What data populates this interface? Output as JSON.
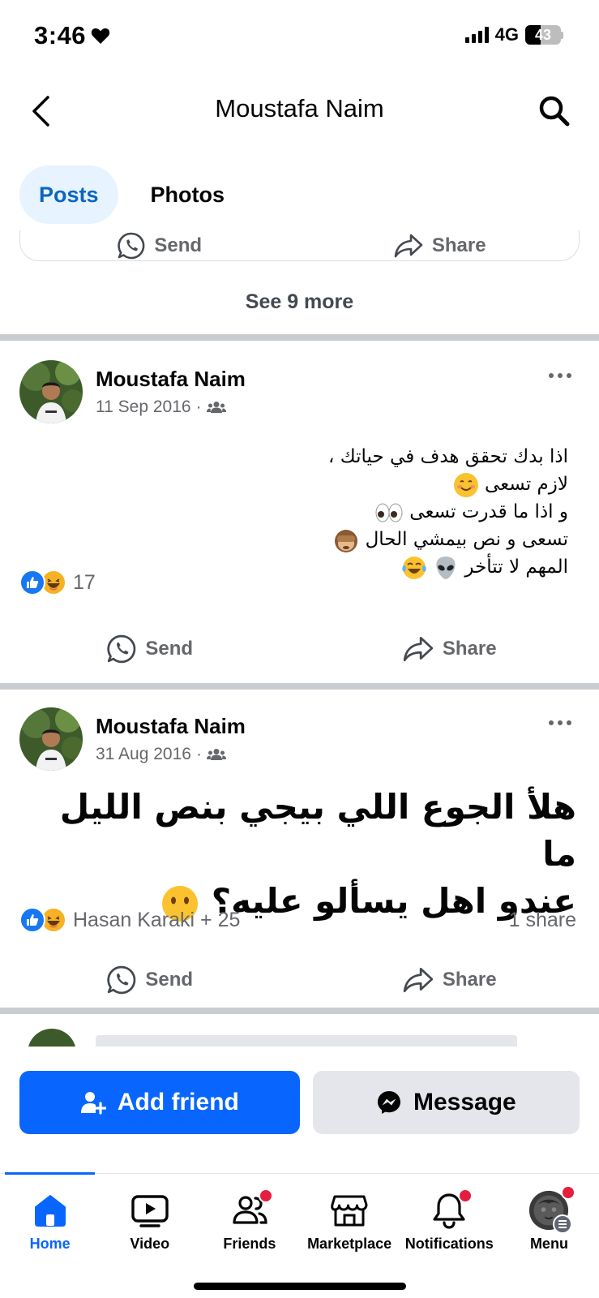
{
  "status_bar": {
    "time": "3:46",
    "network": "4G",
    "battery": "43",
    "battery_level": 0.43
  },
  "header": {
    "title": "Moustafa Naim",
    "back_icon": "chevron-left-icon",
    "search_icon": "search-icon"
  },
  "tabs": [
    {
      "label": "Posts",
      "active": true
    },
    {
      "label": "Photos",
      "active": false
    }
  ],
  "prev_post": {
    "send_label": "Send",
    "share_label": "Share",
    "see_more_label": "See 9 more"
  },
  "posts": [
    {
      "author": "Moustafa Naim",
      "date": "11 Sep 2016",
      "audience_sep": "·",
      "audience_icon": "friends-icon",
      "text_lines": [
        "اذا بدك تحقق هدف في حياتك ،",
        "لازم تسعى",
        "و اذا ما قدرت تسعى",
        "تسعى و نص بيمشي الحال",
        "المهم لا تتأخر"
      ],
      "reaction_count": "17",
      "send_label": "Send",
      "share_label": "Share"
    },
    {
      "author": "Moustafa Naim",
      "date": "31 Aug 2016",
      "audience_sep": "·",
      "audience_icon": "friends-icon",
      "text_lines": [
        "هلأ الجوع اللي بيجي بنص الليل ما",
        "عندو اهل يسألو عليه؟"
      ],
      "reaction_summary": "Hasan Karaki + 25",
      "share_count": "1 share",
      "send_label": "Send",
      "share_label": "Share"
    }
  ],
  "cta": {
    "add_friend_label": "Add friend",
    "message_label": "Message"
  },
  "nav": [
    {
      "label": "Home",
      "icon": "home-icon",
      "active": true,
      "badge": false
    },
    {
      "label": "Video",
      "icon": "video-icon",
      "active": false,
      "badge": false
    },
    {
      "label": "Friends",
      "icon": "friends-icon",
      "active": false,
      "badge": true
    },
    {
      "label": "Marketplace",
      "icon": "marketplace-icon",
      "active": false,
      "badge": false
    },
    {
      "label": "Notifications",
      "icon": "bell-icon",
      "active": false,
      "badge": true
    },
    {
      "label": "Menu",
      "icon": "avatar-icon",
      "active": false,
      "badge": true
    }
  ],
  "colors": {
    "accent": "#0866ff",
    "tab_active_bg": "#e7f3ff",
    "secondary_text": "#65676b",
    "badge": "#e41e3f"
  }
}
